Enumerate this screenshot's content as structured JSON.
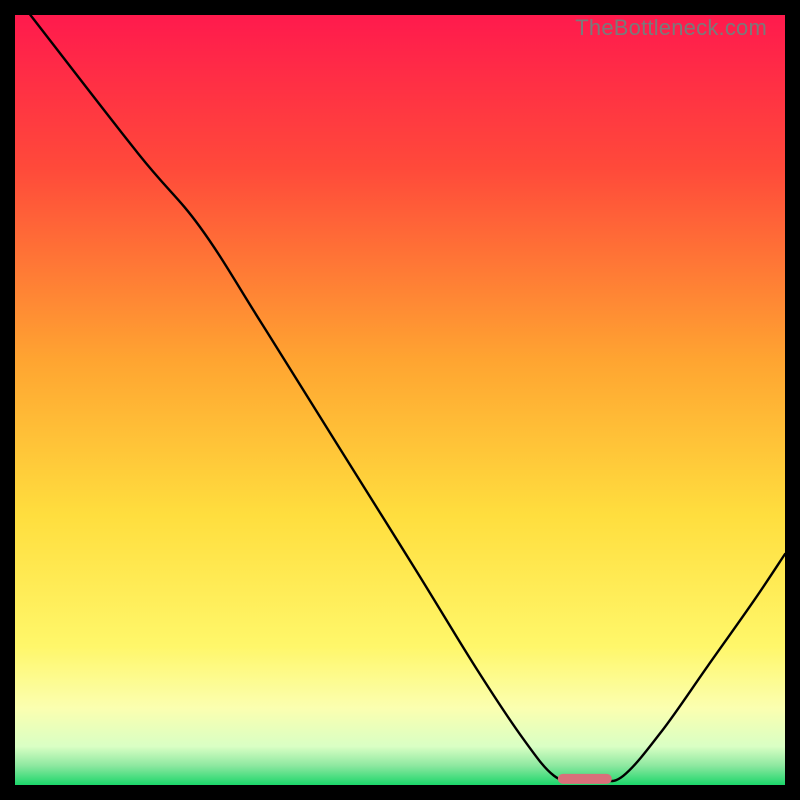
{
  "watermark": "TheBottleneck.com",
  "chart_data": {
    "type": "line",
    "title": "",
    "xlabel": "",
    "ylabel": "",
    "xlim": [
      0,
      100
    ],
    "ylim": [
      0,
      100
    ],
    "gradient_stops": [
      {
        "offset": 0.0,
        "color": "#ff1a4d"
      },
      {
        "offset": 0.2,
        "color": "#ff4a3a"
      },
      {
        "offset": 0.45,
        "color": "#ffa531"
      },
      {
        "offset": 0.65,
        "color": "#ffde3e"
      },
      {
        "offset": 0.82,
        "color": "#fff76a"
      },
      {
        "offset": 0.9,
        "color": "#fbffb0"
      },
      {
        "offset": 0.95,
        "color": "#d9ffc4"
      },
      {
        "offset": 0.975,
        "color": "#8de8a0"
      },
      {
        "offset": 1.0,
        "color": "#1bd66a"
      }
    ],
    "curve_points": [
      {
        "x": 2.0,
        "y": 100.0
      },
      {
        "x": 16.0,
        "y": 82.0
      },
      {
        "x": 24.0,
        "y": 72.5
      },
      {
        "x": 32.0,
        "y": 60.0
      },
      {
        "x": 42.0,
        "y": 44.0
      },
      {
        "x": 52.0,
        "y": 28.0
      },
      {
        "x": 60.0,
        "y": 15.0
      },
      {
        "x": 66.0,
        "y": 6.0
      },
      {
        "x": 70.0,
        "y": 1.2
      },
      {
        "x": 73.0,
        "y": 0.6
      },
      {
        "x": 76.0,
        "y": 0.6
      },
      {
        "x": 79.0,
        "y": 1.2
      },
      {
        "x": 84.0,
        "y": 7.0
      },
      {
        "x": 90.0,
        "y": 15.5
      },
      {
        "x": 96.0,
        "y": 24.0
      },
      {
        "x": 100.0,
        "y": 30.0
      }
    ],
    "optimal_marker": {
      "x_start": 70.5,
      "x_end": 77.5,
      "y": 0.8,
      "color": "#d9707a"
    }
  }
}
